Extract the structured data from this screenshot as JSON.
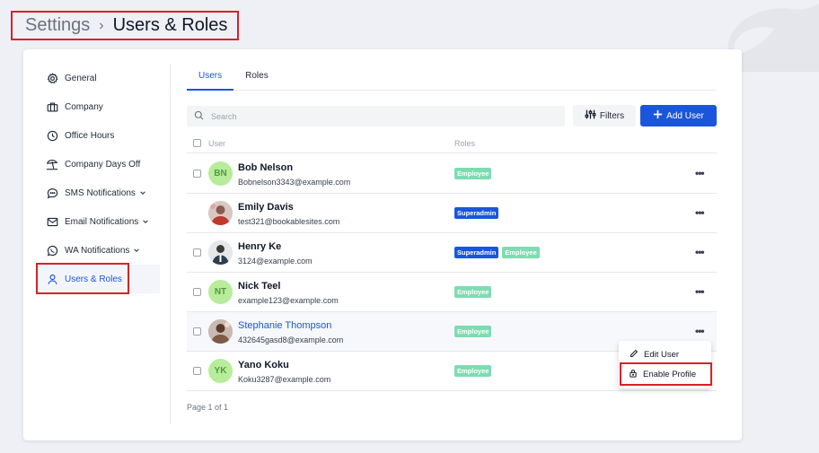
{
  "breadcrumb": {
    "parent": "Settings",
    "separator": "›",
    "current": "Users & Roles"
  },
  "sidebar": {
    "items": [
      {
        "label": "General",
        "icon": "gear-icon"
      },
      {
        "label": "Company",
        "icon": "briefcase-icon"
      },
      {
        "label": "Office Hours",
        "icon": "clock-icon"
      },
      {
        "label": "Company Days Off",
        "icon": "beach-umbrella-icon"
      },
      {
        "label": "SMS Notifications",
        "icon": "chat-bubble-icon"
      },
      {
        "label": "Email Notifications",
        "icon": "envelope-icon"
      },
      {
        "label": "WA Notifications",
        "icon": "whatsapp-icon"
      },
      {
        "label": "Users & Roles",
        "icon": "user-icon",
        "active": true
      }
    ]
  },
  "tabs": [
    {
      "label": "Users",
      "active": true
    },
    {
      "label": "Roles"
    }
  ],
  "search": {
    "placeholder": "Search"
  },
  "toolbar": {
    "filters_label": "Filters",
    "add_user_label": "Add User"
  },
  "table": {
    "columns": {
      "user": "User",
      "roles": "Roles"
    },
    "rows": [
      {
        "name": "Bob Nelson",
        "email": "Bobnelson3343@example.com",
        "initials": "BN",
        "roles": [
          "Employee"
        ]
      },
      {
        "name": "Emily Davis",
        "email": "test321@bookablesites.com",
        "initials": "",
        "roles": [
          "Superadmin"
        ]
      },
      {
        "name": "Henry Ke",
        "email": "3124@example.com",
        "initials": "",
        "roles": [
          "Superadmin",
          "Employee"
        ]
      },
      {
        "name": "Nick Teel",
        "email": "example123@example.com",
        "initials": "NT",
        "roles": [
          "Employee"
        ]
      },
      {
        "name": "Stephanie Thompson",
        "email": "432645gasd8@example.com",
        "initials": "",
        "roles": [
          "Employee"
        ]
      },
      {
        "name": "Yano Koku",
        "email": "Koku3287@example.com",
        "initials": "YK",
        "roles": [
          "Employee"
        ]
      }
    ]
  },
  "pagination": {
    "text": "Page 1 of 1"
  },
  "context_menu": {
    "edit_label": "Edit User",
    "enable_label": "Enable Profile"
  },
  "colors": {
    "accent": "#1a56db",
    "employee_badge": "#7ddcb2",
    "highlight_outline": "#d92128"
  }
}
